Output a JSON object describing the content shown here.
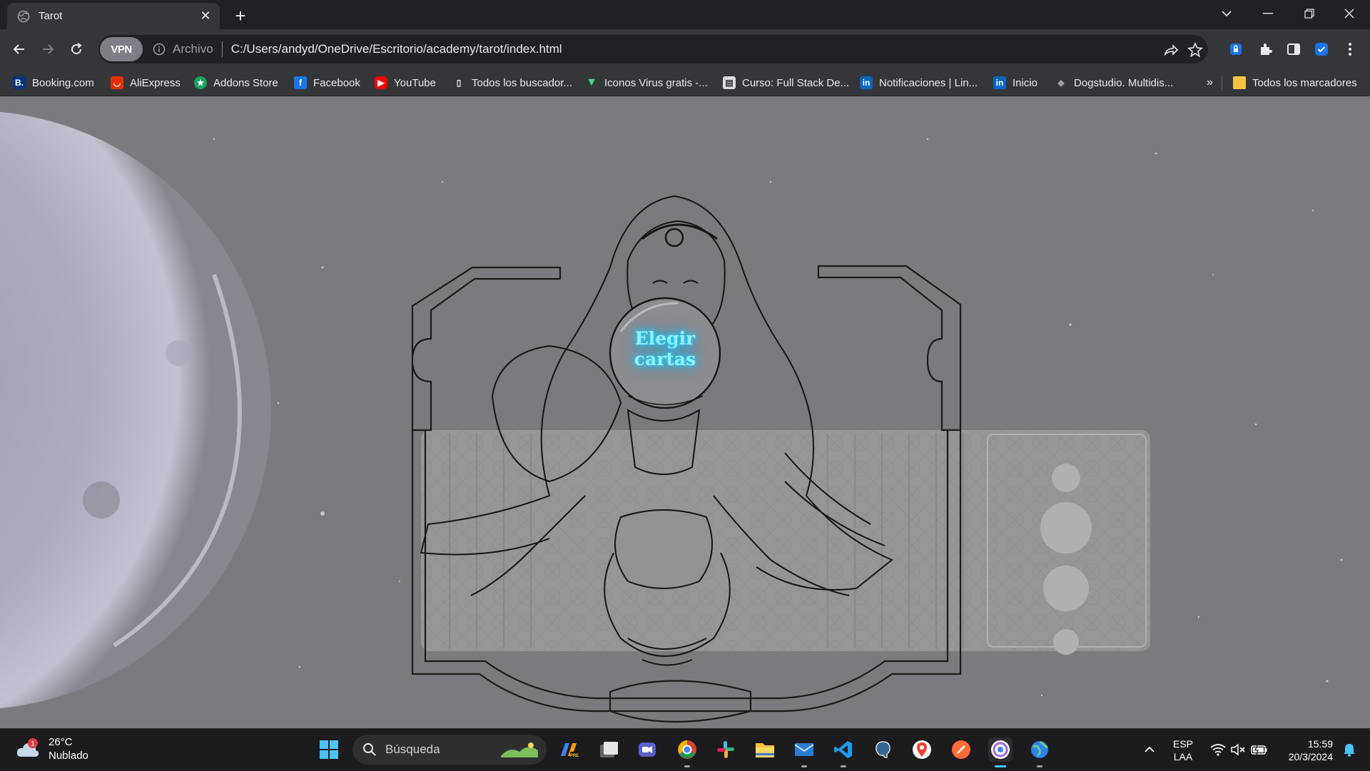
{
  "browser": {
    "tab_title": "Tarot",
    "address": {
      "vpn_label": "VPN",
      "scheme_label": "Archivo",
      "url": "C:/Users/andyd/OneDrive/Escritorio/academy/tarot/index.html"
    },
    "bookmarks": [
      {
        "label": "Booking.com",
        "icon": "booking-icon",
        "color": "#003580"
      },
      {
        "label": "AliExpress",
        "icon": "aliexpress-icon",
        "color": "#e62e04"
      },
      {
        "label": "Addons Store",
        "icon": "addons-store-icon",
        "color": "#1aa260"
      },
      {
        "label": "Facebook",
        "icon": "facebook-icon",
        "color": "#1877f2"
      },
      {
        "label": "YouTube",
        "icon": "youtube-icon",
        "color": "#ff0000"
      },
      {
        "label": "Todos los buscador...",
        "icon": "bookmark-page-icon",
        "color": "#5f6368"
      },
      {
        "label": "Iconos Virus gratis -...",
        "icon": "iconos-virus-icon",
        "color": "#3ddc84"
      },
      {
        "label": "Curso: Full Stack De...",
        "icon": "course-icon",
        "color": "#9aa0a6"
      },
      {
        "label": "Notificaciones | Lin...",
        "icon": "linkedin-icon",
        "color": "#0a66c2"
      },
      {
        "label": "Inicio",
        "icon": "linkedin-icon",
        "color": "#0a66c2"
      },
      {
        "label": "Dogstudio. Multidis...",
        "icon": "dogstudio-icon",
        "color": "#5f6368"
      }
    ],
    "overflow_label": "»",
    "all_bookmarks_label": "Todos los marcadores"
  },
  "page": {
    "cta_label": "Elegir cartas",
    "accent_color": "#29d8ff"
  },
  "taskbar": {
    "weather": {
      "temp": "26°C",
      "condition": "Nublado",
      "badge": "1"
    },
    "search_placeholder": "Búsqueda",
    "apps": [
      "start-icon",
      "search-icon",
      "copilot-icon",
      "task-view-icon",
      "meet-icon",
      "chrome-icon",
      "slack-icon",
      "file-explorer-icon",
      "mail-icon",
      "vscode-icon",
      "postgresql-icon",
      "maps-icon",
      "postman-icon",
      "chrome-active-icon",
      "browser-globe-icon"
    ],
    "language": {
      "line1": "ESP",
      "line2": "LAA"
    },
    "time": "15:59",
    "date": "20/3/2024"
  }
}
